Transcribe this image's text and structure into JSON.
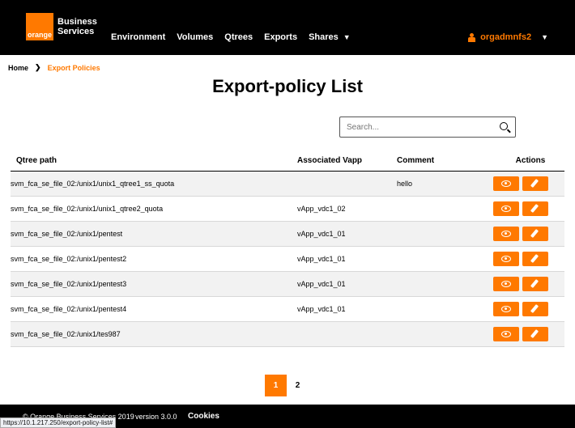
{
  "header": {
    "logo_text": "orange",
    "brand_line1": "Business",
    "brand_line2": "Services",
    "nav": [
      "Environment",
      "Volumes",
      "Qtrees",
      "Exports",
      "Shares"
    ],
    "username": "orgadmnfs2"
  },
  "breadcrumb": {
    "home": "Home",
    "current": "Export Policies"
  },
  "page_title": "Export-policy List",
  "search": {
    "placeholder": "Search..."
  },
  "table": {
    "headers": [
      "Qtree path",
      "Associated Vapp",
      "Comment",
      "Actions"
    ],
    "rows": [
      {
        "path": "svm_fca_se_file_02:/unix1/unix1_qtree1_ss_quota",
        "vapp": "",
        "comment": "hello"
      },
      {
        "path": "svm_fca_se_file_02:/unix1/unix1_qtree2_quota",
        "vapp": "vApp_vdc1_02",
        "comment": ""
      },
      {
        "path": "svm_fca_se_file_02:/unix1/pentest",
        "vapp": "vApp_vdc1_01",
        "comment": ""
      },
      {
        "path": "svm_fca_se_file_02:/unix1/pentest2",
        "vapp": "vApp_vdc1_01",
        "comment": ""
      },
      {
        "path": "svm_fca_se_file_02:/unix1/pentest3",
        "vapp": "vApp_vdc1_01",
        "comment": ""
      },
      {
        "path": "svm_fca_se_file_02:/unix1/pentest4",
        "vapp": "vApp_vdc1_01",
        "comment": ""
      },
      {
        "path": "svm_fca_se_file_02:/unix1/tes987",
        "vapp": "",
        "comment": ""
      }
    ]
  },
  "pagination": {
    "pages": [
      "1",
      "2"
    ],
    "current": "1"
  },
  "footer": {
    "copyright": "© Orange Business Services 2019",
    "version": "version 3.0.0",
    "cookies": "Cookies"
  },
  "status_url": "https://10.1.217.250/export-policy-list#",
  "colors": {
    "accent": "#ff7900",
    "header_bg": "#000000"
  }
}
